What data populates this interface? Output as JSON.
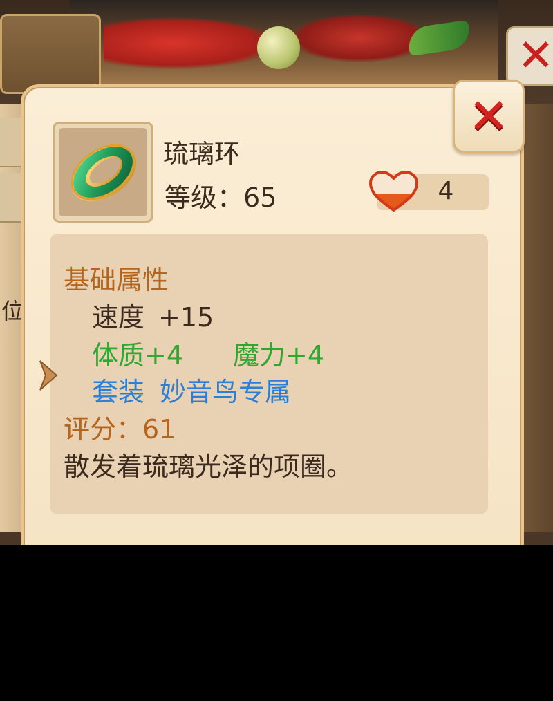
{
  "background": {
    "close_glyph": "✕",
    "side_label": "位"
  },
  "popup": {
    "close_glyph": "✕",
    "item": {
      "icon": "jade-ring-icon",
      "name": "琉璃环",
      "level_label": "等级：",
      "level_value": "65",
      "heart_icon": "heart-icon",
      "heart_value": "4"
    },
    "details": {
      "section_title": "基础属性",
      "stat_name": "速度",
      "stat_value": "+15",
      "bonus_1": "体质+4",
      "bonus_2": "魔力+4",
      "set_label": "套装",
      "set_value": "妙音鸟专属",
      "score_label": "评分：",
      "score_value": "61",
      "flavor_text": "散发着琉璃光泽的项圈。"
    }
  },
  "colors": {
    "section_title": "#b5651d",
    "green_bonus": "#2fa82f",
    "set_blue": "#2b7fd6",
    "close_red": "#d4231f"
  }
}
